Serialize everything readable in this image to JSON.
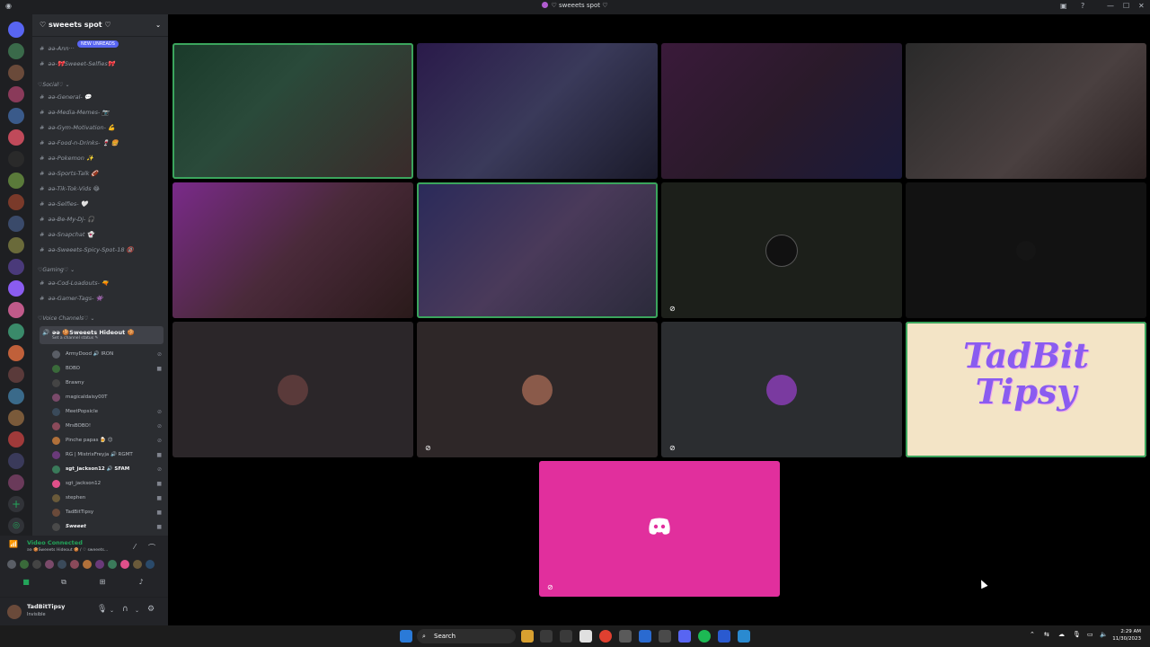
{
  "window": {
    "title": "♡ sweeets spot ♡"
  },
  "server": {
    "name": "♡ sweeets spot ♡",
    "new_unreads": "NEW UNREADS",
    "top_channels": [
      "əə-Ann···",
      "əə-🎀Sweeet-Selfies🎀"
    ]
  },
  "categories": {
    "social": "♡Social♡ ⌄",
    "gaming": "♡Gaming♡ ⌄",
    "voice": "♡Voice Channels♡ ⌄"
  },
  "social_channels": [
    "əə-General- 💬",
    "əə-Media-Memes- 📷",
    "əə-Gym-Motivation- 💪",
    "əə-Food-n-Drinks- 🍷 🍔",
    "əə-Pokemon ✨",
    "əə-Sports-Talk 🏈",
    "əə-Tik-Tok-Vids 😂",
    "əə-Selfies- 🤍",
    "əə-Be-My-Dj- 🎧",
    "əə-Snapchat 👻",
    "əə-Sweeets-Spicy-Spot-18 🔞"
  ],
  "gaming_channels": [
    "əə-Cod-Loadouts- 🔫",
    "əə-Gamer-Tags- 👾"
  ],
  "voice_channel": {
    "name": "əə 🍪Sweeets Hideout 🍪",
    "status": "Set a channel status ✎"
  },
  "members": [
    {
      "name": "ArmyDood 🔊 IRON",
      "color": "#5a5e66"
    },
    {
      "name": "BOBO",
      "color": "#3a6a3a"
    },
    {
      "name": "Brawny",
      "color": "#444"
    },
    {
      "name": "magicaldaisy00T",
      "color": "#7a4a6a"
    },
    {
      "name": "MeetPopsicle",
      "color": "#3a4a5a"
    },
    {
      "name": "MrsBOBO!",
      "color": "#8a4a5a"
    },
    {
      "name": "Pinche papas 🍺 😊",
      "color": "#b0703a"
    },
    {
      "name": "RG | MistrixFreyja 🔊 RGMT",
      "color": "#6a3a7a"
    },
    {
      "name": "sgt_jackson12 🔊 SFAM",
      "color": "#3a7a5a"
    },
    {
      "name": "sgt_jackson12",
      "color": "#e0508a"
    },
    {
      "name": "stephen",
      "color": "#6a5a3a"
    },
    {
      "name": "TadBitTipsy",
      "color": "#6a4a3a"
    },
    {
      "name": "Sweeet",
      "color": "#4a4a4a"
    }
  ],
  "voice_status": {
    "title": "Video Connected",
    "subtitle": "əə 🍪Sweeets Hideout 🍪 / ♡ sweeets..."
  },
  "user": {
    "name": "TadBitTipsy",
    "status": "Invisible"
  },
  "stage": {
    "tadbit_logo_1": "TadBit",
    "tadbit_logo_2": "Tipsy"
  },
  "taskbar": {
    "search": "Search",
    "time": "2:29 AM",
    "date": "11/30/2023"
  }
}
